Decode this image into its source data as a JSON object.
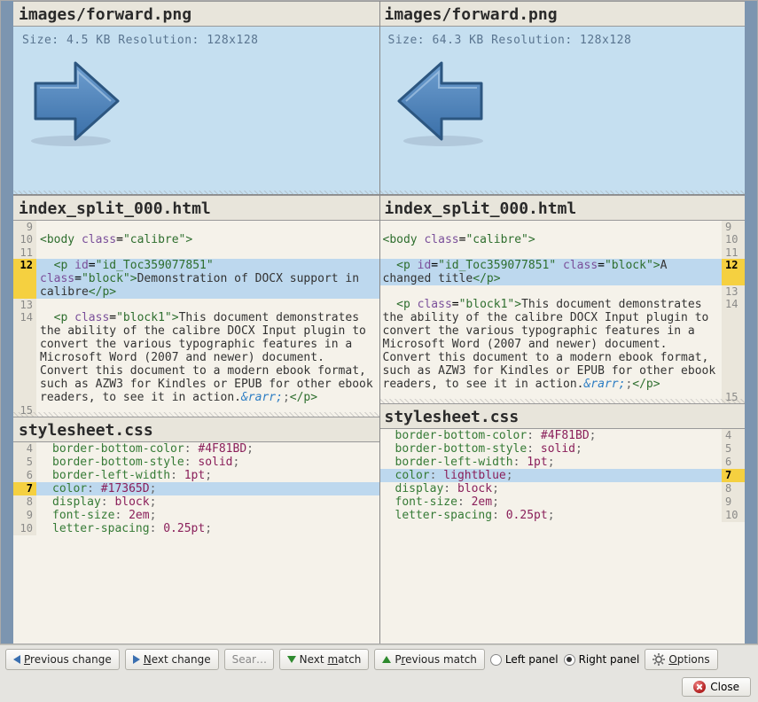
{
  "files": {
    "image": {
      "name": "images/forward.png",
      "left": {
        "size_label": "Size:",
        "size": "4.5 KB",
        "res_label": "Resolution:",
        "res": "128x128"
      },
      "right": {
        "size_label": "Size:",
        "size": "64.3 KB",
        "res_label": "Resolution:",
        "res": "128x128"
      }
    },
    "html": {
      "name": "index_split_000.html",
      "left": {
        "lines": [
          "9",
          "10",
          "11",
          "12",
          "",
          "",
          "13",
          "14",
          "",
          "",
          "",
          "",
          "",
          "",
          "15"
        ],
        "body_open": "<body class=\"calibre\">",
        "p1_open": "  <p id=\"id_Toc359077851\" class=\"block\">",
        "p1_text": "Demonstration of DOCX support in calibre",
        "p1_close": "</p>",
        "p2": "  <p class=\"block1\">This document demonstrates the ability of the calibre DOCX Input plugin to convert the various typographic features in a Microsoft Word (2007 and newer) document. Convert this document to a modern ebook format, such as AZW3 for Kindles or EPUB for other ebook readers, to see it in action.",
        "p2_ent": "&rarr;",
        "p2_close": "</p>"
      },
      "right": {
        "lines": [
          "9",
          "10",
          "11",
          "12",
          "",
          "13",
          "14",
          "",
          "",
          "",
          "",
          "",
          "",
          "15"
        ],
        "body_open": "<body class=\"calibre\">",
        "p1_open": "  <p id=\"id_Toc359077851\" class=\"block\">",
        "p1_text": "A changed title",
        "p1_close": "</p>",
        "p2": "  <p class=\"block1\">This document demonstrates the ability of the calibre DOCX Input plugin to convert the various typographic features in a Microsoft Word (2007 and newer) document. Convert this document to a modern ebook format, such as AZW3 for Kindles or EPUB for other ebook readers, to see it in action.",
        "p2_ent": "&rarr;",
        "p2_close": "</p>"
      }
    },
    "css": {
      "name": "stylesheet.css",
      "left": {
        "lines": [
          "4",
          "5",
          "6",
          "7",
          "8",
          "9",
          "10"
        ],
        "rows": [
          {
            "prop": "border-bottom-color",
            "val": "#4F81BD"
          },
          {
            "prop": "border-bottom-style",
            "val": "solid"
          },
          {
            "prop": "border-left-width",
            "val": "1pt"
          },
          {
            "prop": "color",
            "val": "#17365D",
            "changed": true
          },
          {
            "prop": "display",
            "val": "block"
          },
          {
            "prop": "font-size",
            "val": "2em"
          },
          {
            "prop": "letter-spacing",
            "val": "0.25pt"
          }
        ]
      },
      "right": {
        "lines": [
          "4",
          "5",
          "6",
          "7",
          "8",
          "9",
          "10"
        ],
        "rows": [
          {
            "prop": "border-bottom-color",
            "val": "#4F81BD"
          },
          {
            "prop": "border-bottom-style",
            "val": "solid"
          },
          {
            "prop": "border-left-width",
            "val": "1pt"
          },
          {
            "prop": "color",
            "val": "lightblue",
            "changed": true
          },
          {
            "prop": "display",
            "val": "block"
          },
          {
            "prop": "font-size",
            "val": "2em"
          },
          {
            "prop": "letter-spacing",
            "val": "0.25pt"
          }
        ]
      }
    }
  },
  "toolbar": {
    "prev_change": "Previous change",
    "next_change": "Next change",
    "search_placeholder": "Sear…",
    "next_match": "Next match",
    "prev_match": "Previous match",
    "left_panel": "Left panel",
    "right_panel": "Right panel",
    "options": "Options",
    "close": "Close"
  },
  "colors": {
    "accent": "#3a6fb0",
    "change_bg": "#bdd8ee",
    "change_ln": "#f5d040"
  }
}
